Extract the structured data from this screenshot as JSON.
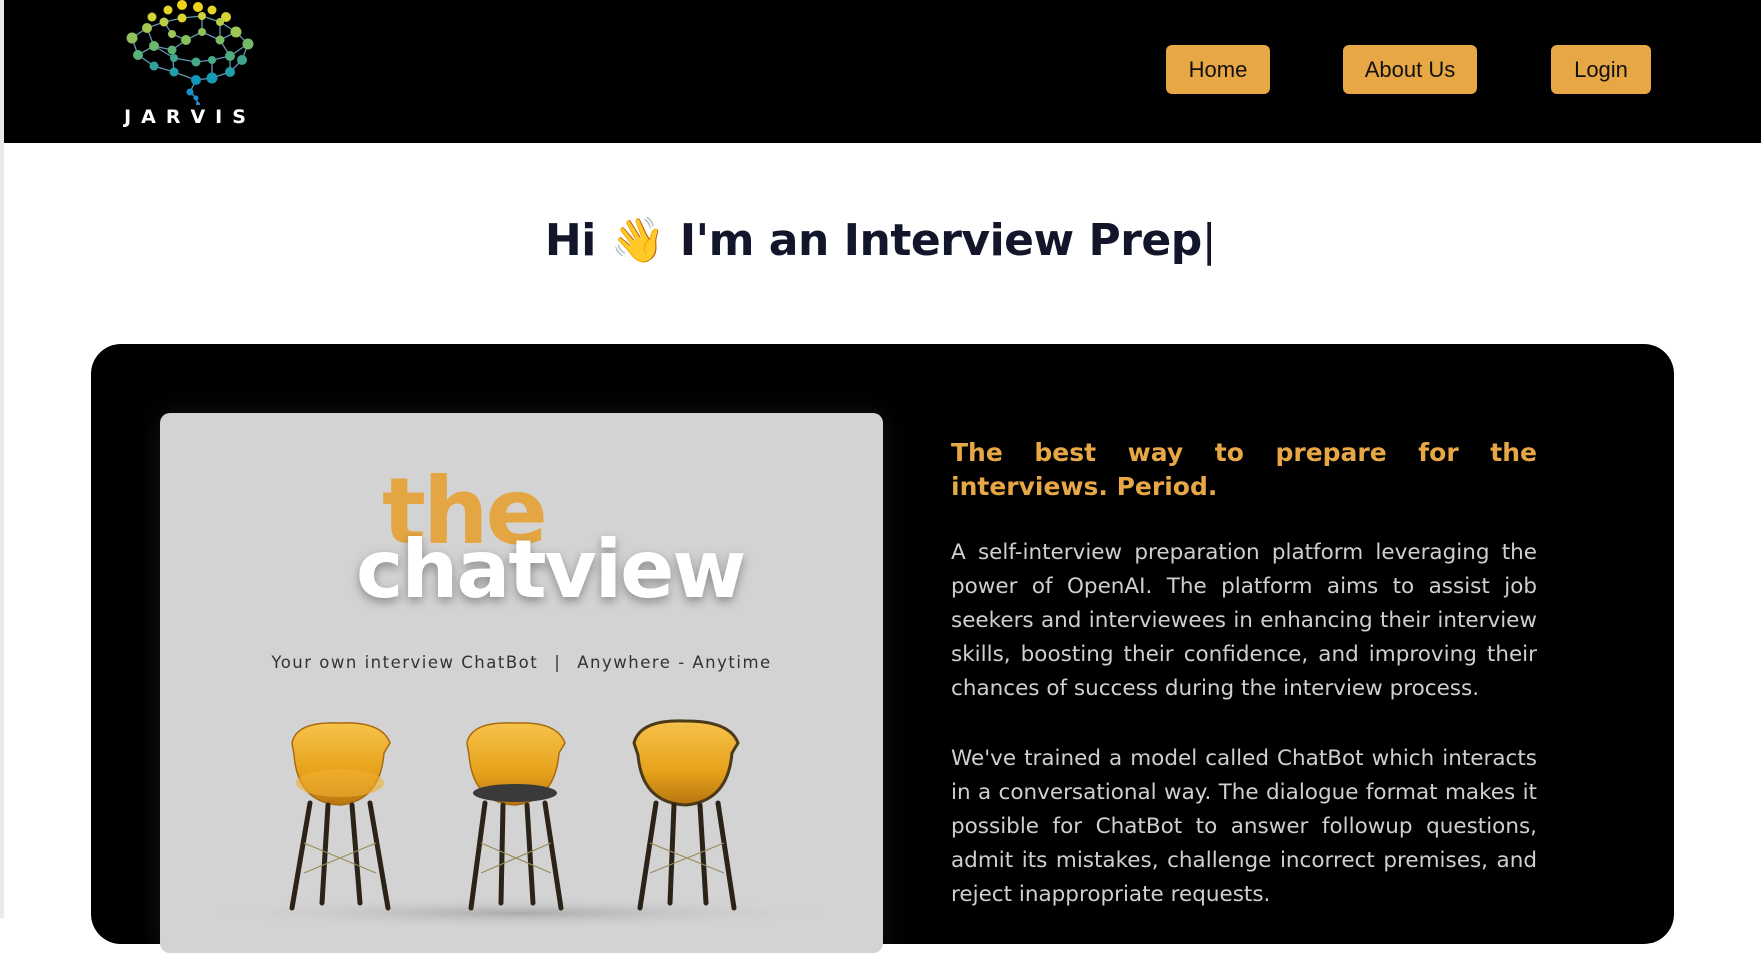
{
  "logo": {
    "text": "JARVIS",
    "icon": "brain-network-icon"
  },
  "nav": {
    "home": "Home",
    "about": "About Us",
    "login": "Login"
  },
  "hero": {
    "greeting": "Hi",
    "wave_emoji": "👋",
    "title": "I'm an Interview Prep",
    "cursor": "|"
  },
  "promo": {
    "the": "the",
    "brand": "chatview",
    "tagline_left": "Your own interview ChatBot",
    "tagline_sep": "|",
    "tagline_right": "Anywhere - Anytime"
  },
  "about": {
    "headline": "The best way to prepare for the interviews. Period.",
    "paragraph1": "A self-interview preparation platform leveraging the power of OpenAI. The platform aims to assist job seekers and interviewees in enhancing their interview skills, boosting their confidence, and improving their chances of success during the interview process.",
    "paragraph2": "We've trained a model called ChatBot which interacts in a conversational way. The dialogue format makes it possible for ChatBot to answer followup questions, admit its mistakes, challenge incorrect premises, and reject inappropriate requests."
  },
  "colors": {
    "accent": "#e8a745",
    "navbar": "#000000",
    "card": "#000000",
    "title": "#13162b",
    "body_text": "#cfcfcf"
  }
}
